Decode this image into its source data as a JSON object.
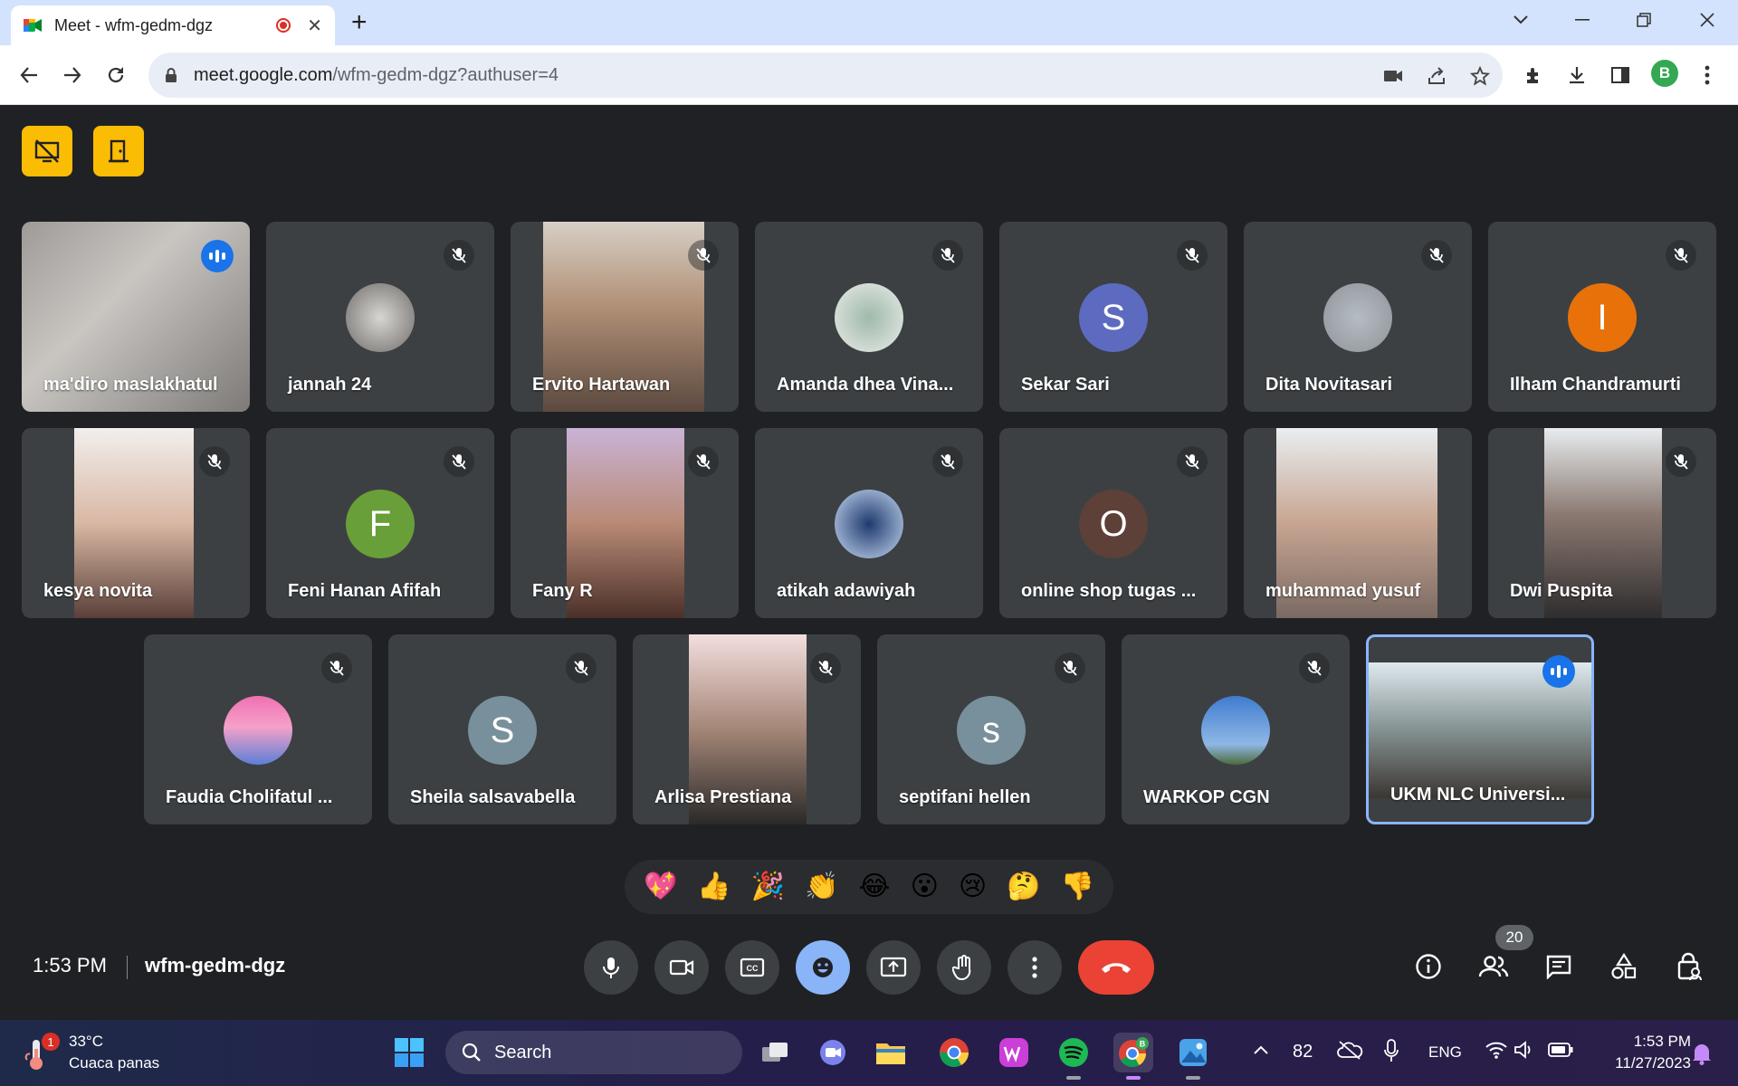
{
  "browser": {
    "tab_title": "Meet - wfm-gedm-dgz",
    "url_host": "meet.google.com",
    "url_path": "/wfm-gedm-dgz?authuser=4",
    "profile_initial": "B"
  },
  "participants_row1": [
    {
      "name": "ma'diro maslakhatul",
      "kind": "video",
      "speaking": true
    },
    {
      "name": "jannah 24",
      "kind": "photo"
    },
    {
      "name": "Ervito Hartawan",
      "kind": "video"
    },
    {
      "name": "Amanda dhea Vina...",
      "kind": "photo"
    },
    {
      "name": "Sekar Sari",
      "kind": "letter",
      "initial": "S",
      "color": "#5c6bc0"
    },
    {
      "name": "Dita Novitasari",
      "kind": "photo"
    },
    {
      "name": "Ilham Chandramurti",
      "kind": "letter",
      "initial": "I",
      "color": "#e8710a"
    }
  ],
  "participants_row2": [
    {
      "name": "kesya novita",
      "kind": "video"
    },
    {
      "name": "Feni Hanan Afifah",
      "kind": "letter",
      "initial": "F",
      "color": "#689f38"
    },
    {
      "name": "Fany R",
      "kind": "video"
    },
    {
      "name": "atikah adawiyah",
      "kind": "photo"
    },
    {
      "name": "online shop tugas ...",
      "kind": "letter",
      "initial": "O",
      "color": "#5d4037"
    },
    {
      "name": "muhammad yusuf",
      "kind": "video"
    },
    {
      "name": "Dwi Puspita",
      "kind": "video"
    }
  ],
  "participants_row3": [
    {
      "name": "Faudia Cholifatul ...",
      "kind": "photo"
    },
    {
      "name": "Sheila salsavabella",
      "kind": "letter",
      "initial": "S",
      "color": "#78909c"
    },
    {
      "name": "Arlisa Prestiana",
      "kind": "video"
    },
    {
      "name": "septifani hellen",
      "kind": "letter",
      "initial": "s",
      "color": "#78909c"
    },
    {
      "name": "WARKOP CGN",
      "kind": "photo"
    },
    {
      "name": "UKM NLC Universi...",
      "kind": "video",
      "speaking": true,
      "active": true
    }
  ],
  "reactions": [
    "💖",
    "👍",
    "🎉",
    "👏",
    "😂",
    "😮",
    "😢",
    "🤔",
    "👎"
  ],
  "meeting": {
    "time": "1:53 PM",
    "code": "wfm-gedm-dgz",
    "participant_count": "20"
  },
  "taskbar": {
    "weather_temp": "33°C",
    "weather_desc": "Cuaca panas",
    "weather_alert": "1",
    "search_label": "Search",
    "battery_pct": "82",
    "lang": "ENG",
    "time": "1:53 PM",
    "date": "11/27/2023"
  }
}
